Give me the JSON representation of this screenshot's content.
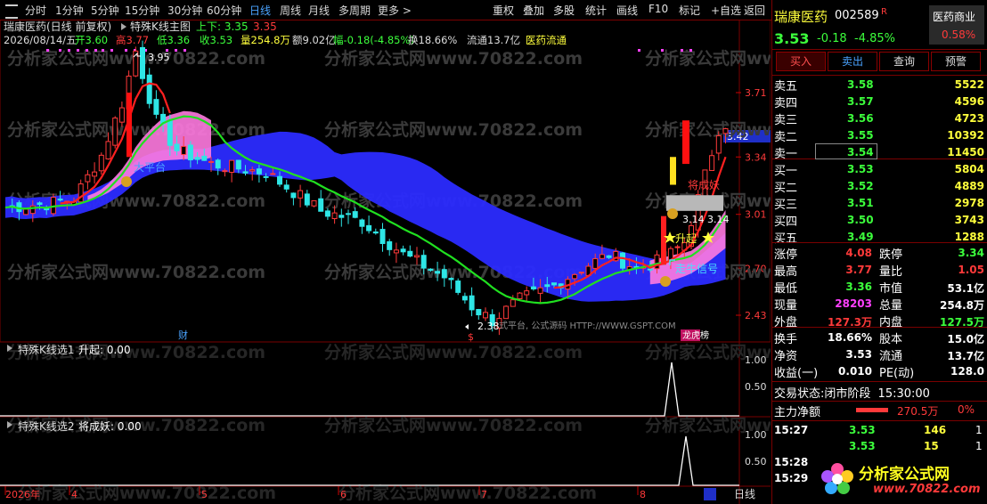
{
  "toolbar": {
    "periods": [
      "分时",
      "1分钟",
      "5分钟",
      "15分钟",
      "30分钟",
      "60分钟",
      "日线",
      "周线",
      "月线",
      "多周期",
      "更多 >"
    ],
    "active": "日线",
    "right_buttons": [
      "重权",
      "叠加",
      "多股",
      "统计",
      "画线",
      "F10",
      "标记",
      "+自选",
      "返回"
    ]
  },
  "chart_header": {
    "title": "瑞康医药(日线 前复权)",
    "indicator": "特殊K线主图",
    "updown_label": "上下: 3.35",
    "updown_value": "3.35",
    "date": "2026/08/14/五",
    "open": "开3.60",
    "high": "高3.77",
    "low": "低3.36",
    "close": "收3.53",
    "volume": "量254.8万",
    "amount": "额9.02亿",
    "change": "幅-0.18(-4.85%)",
    "turnover": "换18.66%",
    "float": "流通13.7亿",
    "sector": "医药流通"
  },
  "price_axis": [
    "3.71",
    "3.34",
    "3.01",
    "2.70",
    "2.43"
  ],
  "current_price_tag": "3.42",
  "annotations": {
    "high_mark": "3.95",
    "low_mark": "2.38",
    "label_jcy": "将成妖",
    "label_range": "3.14 3.14",
    "label_rise": "升起",
    "label_bull": "走牛信号",
    "label_qk": "大平台",
    "watermark": "分析家公式网www.70822.com",
    "platform_text": "式平台, 公式源码 HTTP://WWW.GSPT.COM",
    "tag_cai": "财",
    "tag_long": "龙虎榜",
    "dollar": "$"
  },
  "sub1": {
    "title": "特殊K线选1",
    "label": "升起: 0.00",
    "axis": [
      "1.00",
      "0.50"
    ]
  },
  "sub2": {
    "title": "特殊K线选2",
    "label": "将成妖: 0.00",
    "axis": [
      "1.00",
      "0.50"
    ]
  },
  "time_axis": {
    "labels": [
      "2026年",
      "4",
      "5",
      "6",
      "7",
      "8"
    ],
    "period": "日线"
  },
  "stock": {
    "name": "瑞康医药",
    "code": "002589",
    "flag": "R",
    "industry": "医药商业",
    "industry_pct": "0.58%",
    "price": "3.53",
    "change": "-0.18",
    "pct": "-4.85%"
  },
  "buttons": [
    "买入",
    "卖出",
    "查询",
    "预警"
  ],
  "asks": [
    {
      "label": "卖五",
      "price": "3.58",
      "vol": "5522"
    },
    {
      "label": "卖四",
      "price": "3.57",
      "vol": "4596"
    },
    {
      "label": "卖三",
      "price": "3.56",
      "vol": "4723"
    },
    {
      "label": "卖二",
      "price": "3.55",
      "vol": "10392"
    },
    {
      "label": "卖一",
      "price": "3.54",
      "vol": "11450"
    }
  ],
  "bids": [
    {
      "label": "买一",
      "price": "3.53",
      "vol": "5804"
    },
    {
      "label": "买二",
      "price": "3.52",
      "vol": "4889"
    },
    {
      "label": "买三",
      "price": "3.51",
      "vol": "2978"
    },
    {
      "label": "买四",
      "price": "3.50",
      "vol": "3743"
    },
    {
      "label": "买五",
      "price": "3.49",
      "vol": "1288"
    }
  ],
  "stats": [
    {
      "l1": "涨停",
      "v1": "4.08",
      "c1": "red",
      "l2": "跌停",
      "v2": "3.34",
      "c2": "green"
    },
    {
      "l1": "最高",
      "v1": "3.77",
      "c1": "red",
      "l2": "量比",
      "v2": "1.05",
      "c2": "red"
    },
    {
      "l1": "最低",
      "v1": "3.36",
      "c1": "green",
      "l2": "市值",
      "v2": "53.1亿",
      "c2": "white"
    },
    {
      "l1": "现量",
      "v1": "28203",
      "c1": "magenta",
      "l2": "总量",
      "v2": "254.8万",
      "c2": "white"
    },
    {
      "l1": "外盘",
      "v1": "127.3万",
      "c1": "red",
      "l2": "内盘",
      "v2": "127.5万",
      "c2": "green"
    }
  ],
  "stats2": [
    {
      "l1": "换手",
      "v1": "18.66%",
      "l2": "股本",
      "v2": "15.0亿"
    },
    {
      "l1": "净资",
      "v1": "3.53",
      "l2": "流通",
      "v2": "13.7亿"
    },
    {
      "l1": "收益(一)",
      "v1": "0.010",
      "l2": "PE(动)",
      "v2": "128.0"
    }
  ],
  "trade_status": {
    "label": "交易状态:",
    "value": "闭市阶段",
    "time": "15:30:00"
  },
  "net_flow": {
    "label": "主力净额",
    "value": "270.5万",
    "pct": "0%"
  },
  "ticks": [
    {
      "time": "15:27",
      "price": "3.53",
      "vol": "146",
      "n": "1"
    },
    {
      "time": "",
      "price": "3.53",
      "vol": "15",
      "n": "1"
    },
    {
      "time": "15:28",
      "price": "",
      "vol": "",
      "n": ""
    },
    {
      "time": "15:29",
      "price": "",
      "vol": "",
      "n": ""
    }
  ],
  "logo": {
    "text": "分析家公式网",
    "url": "www.70822.com"
  },
  "colors": {
    "up": "#ff3a3a",
    "down": "#2ee6e6",
    "ma_fast": "#ff2020",
    "ma_slow": "#20e020",
    "band_blue": "#2b2bff",
    "band_pink": "#ff7ae0",
    "border": "#7a0000"
  }
}
